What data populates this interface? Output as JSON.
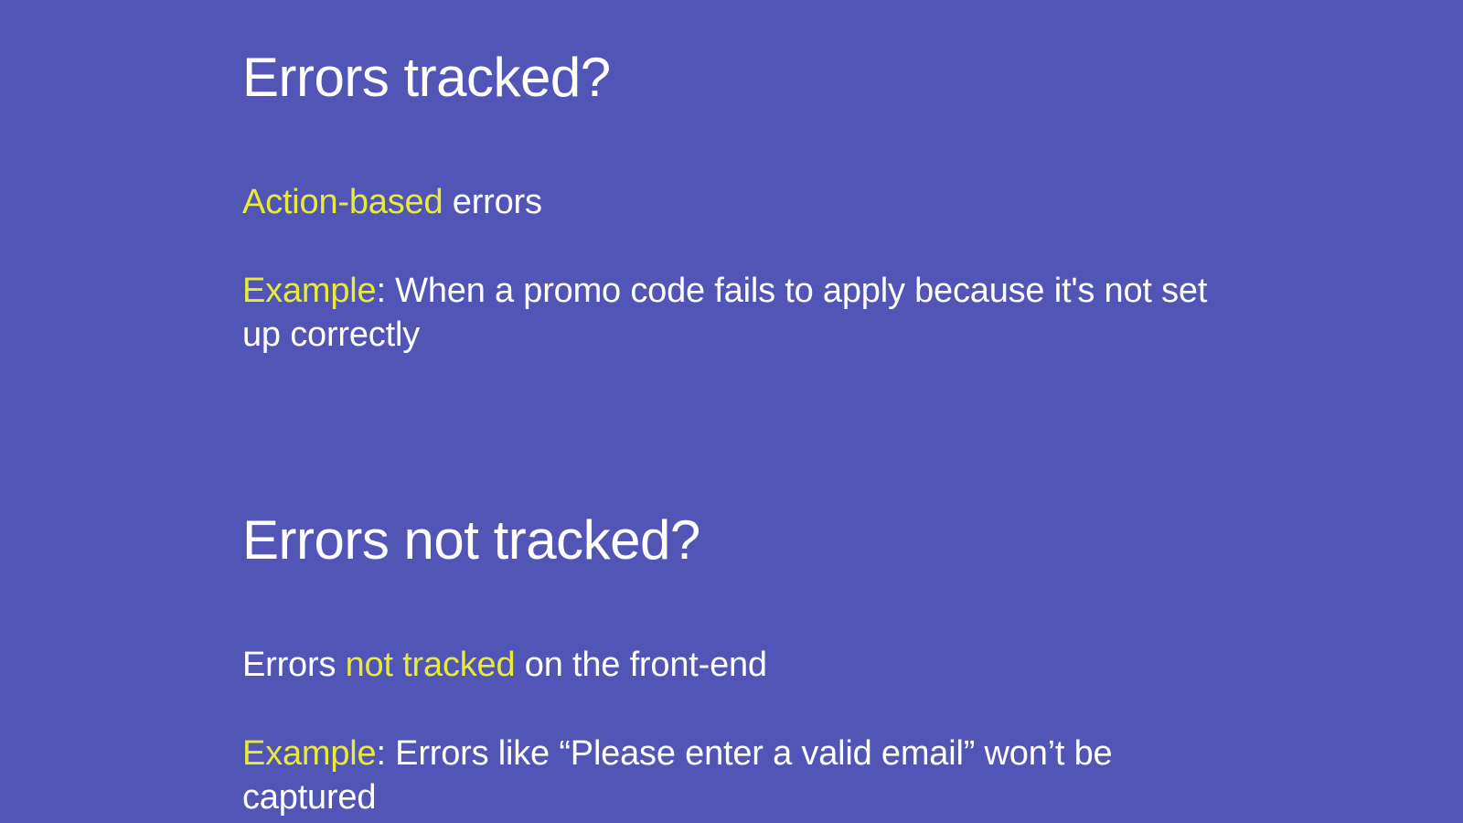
{
  "section1": {
    "heading": "Errors tracked?",
    "line1_highlight": "Action-based",
    "line1_rest": " errors",
    "line2_highlight": "Example",
    "line2_rest": ": When a promo code fails to apply because it's not set up correctly"
  },
  "section2": {
    "heading": "Errors not tracked?",
    "line1_prefix": "Errors ",
    "line1_highlight": "not tracked",
    "line1_suffix": " on the front-end",
    "line2_highlight": "Example",
    "line2_rest": ": Errors like “Please enter a valid email” won’t be captured"
  }
}
